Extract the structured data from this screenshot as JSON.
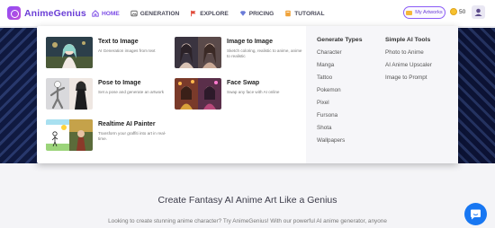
{
  "brand": {
    "name": "AnimeGenius"
  },
  "nav": [
    {
      "label": "HOME",
      "icon": "home-icon"
    },
    {
      "label": "GENERATION",
      "icon": "image-icon"
    },
    {
      "label": "EXPLORE",
      "icon": "flag-icon"
    },
    {
      "label": "PRICING",
      "icon": "diamond-icon"
    },
    {
      "label": "TUTORIAL",
      "icon": "book-icon"
    }
  ],
  "header": {
    "artworks_label": "My Artworks",
    "credits": "50"
  },
  "menu": {
    "tools": [
      {
        "title": "Text to Image",
        "desc": "AI Generation images from text"
      },
      {
        "title": "Image to Image",
        "desc": "Sketch coloring, realistic to anime, anime to realistic"
      },
      {
        "title": "Pose to Image",
        "desc": "Set a pose and generate an artwork"
      },
      {
        "title": "Face Swap",
        "desc": "Swap any face with AI online"
      },
      {
        "title": "Realtime AI Painter",
        "desc": "Transform your graffiti into art in real-time."
      }
    ],
    "generate_types": {
      "heading": "Generate Types",
      "items": [
        "Character",
        "Manga",
        "Tattoo",
        "Pokemon",
        "Pixel",
        "Fursona",
        "Shota",
        "Wallpapers"
      ]
    },
    "simple_tools": {
      "heading": "Simple AI Tools",
      "items": [
        "Photo to Anime",
        "AI Anime Upscaler",
        "Image to Prompt"
      ]
    }
  },
  "main": {
    "headline": "Create Fantasy AI Anime Art Like a Genius",
    "subline": "Looking to create stunning anime character? Try AnimeGenius! With our powerful AI anime generator, anyone"
  },
  "colors": {
    "accent": "#7b4be6",
    "chat": "#1877f2"
  }
}
